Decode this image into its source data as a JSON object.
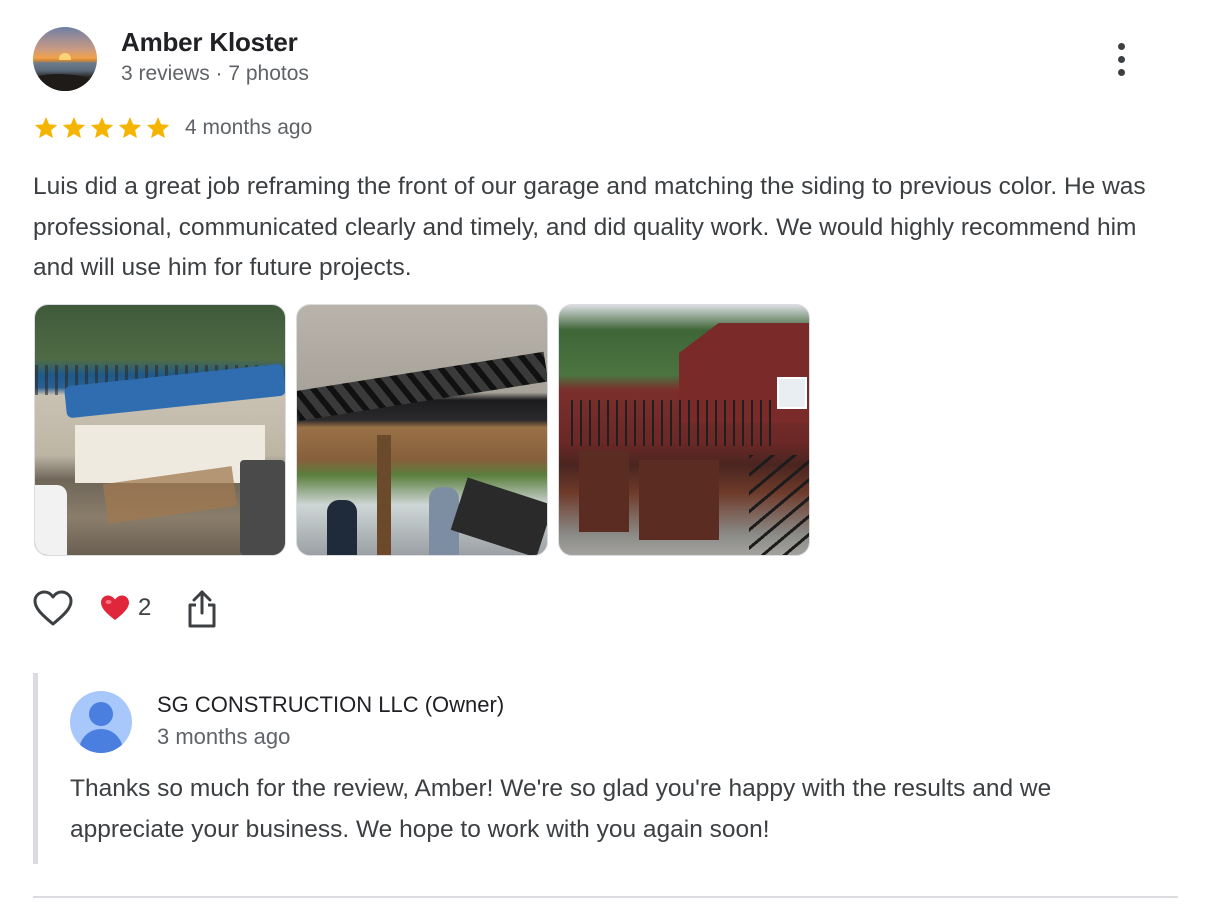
{
  "review": {
    "author": {
      "name": "Amber Kloster",
      "meta": "3 reviews · 7 photos",
      "avatar_icon": "sunset-photo-avatar"
    },
    "rating": {
      "value": 5,
      "max": 5,
      "star_color": "#f4b400"
    },
    "date": "4 months ago",
    "text": "Luis did a great job reframing the front of our garage and matching the siding to previous color. He was professional, communicated clearly and timely, and did quality work. We would highly recommend him and will use him for future projects.",
    "photos": [
      {
        "subject": "garage-demolition-photo"
      },
      {
        "subject": "garage-door-frame-photo"
      },
      {
        "subject": "finished-garage-photo"
      }
    ],
    "actions": {
      "like_icon": "heart-outline-icon",
      "reaction_icon": "red-heart-emoji",
      "reaction_count": "2",
      "share_icon": "share-icon"
    },
    "more_icon": "more-vert-icon"
  },
  "owner_response": {
    "name": "SG CONSTRUCTION LLC (Owner)",
    "date": "3 months ago",
    "text": "Thanks so much for the review, Amber! We're so glad you're happy with the results and we appreciate your business. We hope to work with you again soon!",
    "avatar_icon": "default-person-avatar"
  }
}
